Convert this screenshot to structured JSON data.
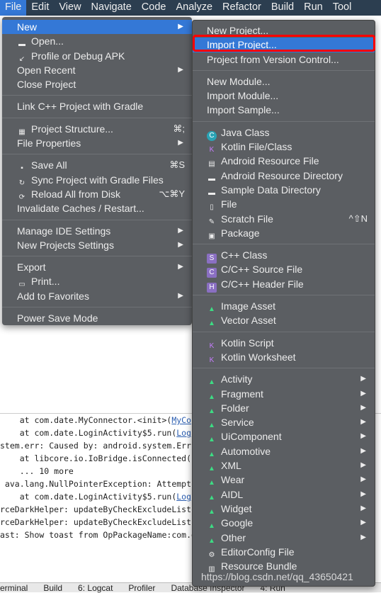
{
  "menubar": [
    "File",
    "Edit",
    "View",
    "Navigate",
    "Code",
    "Analyze",
    "Refactor",
    "Build",
    "Run",
    "Tool"
  ],
  "file_menu": [
    {
      "label": "New",
      "arrow": true,
      "selected": true
    },
    {
      "label": "Open...",
      "icon": "folder-icon"
    },
    {
      "label": "Profile or Debug APK",
      "icon": "profile-apk-icon"
    },
    {
      "label": "Open Recent",
      "arrow": true
    },
    {
      "label": "Close Project"
    },
    {
      "sep": true
    },
    {
      "label": "Link C++ Project with Gradle"
    },
    {
      "sep": true
    },
    {
      "label": "Project Structure...",
      "icon": "project-structure-icon",
      "shortcut": "⌘;"
    },
    {
      "label": "File Properties",
      "arrow": true
    },
    {
      "sep": true
    },
    {
      "label": "Save All",
      "icon": "save-icon",
      "shortcut": "⌘S"
    },
    {
      "label": "Sync Project with Gradle Files",
      "icon": "gradle-sync-icon"
    },
    {
      "label": "Reload All from Disk",
      "icon": "reload-icon",
      "shortcut": "⌥⌘Y"
    },
    {
      "label": "Invalidate Caches / Restart..."
    },
    {
      "sep": true
    },
    {
      "label": "Manage IDE Settings",
      "arrow": true
    },
    {
      "label": "New Projects Settings",
      "arrow": true
    },
    {
      "sep": true
    },
    {
      "label": "Export",
      "arrow": true
    },
    {
      "label": "Print...",
      "icon": "print-icon"
    },
    {
      "label": "Add to Favorites",
      "arrow": true
    },
    {
      "sep": true
    },
    {
      "label": "Power Save Mode"
    }
  ],
  "new_submenu": [
    {
      "label": "New Project..."
    },
    {
      "label": "Import Project...",
      "selected": true
    },
    {
      "label": "Project from Version Control..."
    },
    {
      "sep": true
    },
    {
      "label": "New Module..."
    },
    {
      "label": "Import Module..."
    },
    {
      "label": "Import Sample..."
    },
    {
      "sep": true
    },
    {
      "label": "Java Class",
      "icon": "java-class-icon"
    },
    {
      "label": "Kotlin File/Class",
      "icon": "kotlin-icon"
    },
    {
      "label": "Android Resource File",
      "icon": "android-resource-file-icon"
    },
    {
      "label": "Android Resource Directory",
      "icon": "folder-icon"
    },
    {
      "label": "Sample Data Directory",
      "icon": "folder-icon"
    },
    {
      "label": "File",
      "icon": "file-icon"
    },
    {
      "label": "Scratch File",
      "icon": "scratch-file-icon",
      "shortcut": "^⇧N"
    },
    {
      "label": "Package",
      "icon": "package-icon"
    },
    {
      "sep": true
    },
    {
      "label": "C++ Class",
      "icon": "cpp-class-icon"
    },
    {
      "label": "C/C++ Source File",
      "icon": "cpp-source-icon"
    },
    {
      "label": "C/C++ Header File",
      "icon": "cpp-header-icon"
    },
    {
      "sep": true
    },
    {
      "label": "Image Asset",
      "icon": "android-icon"
    },
    {
      "label": "Vector Asset",
      "icon": "android-icon"
    },
    {
      "sep": true
    },
    {
      "label": "Kotlin Script",
      "icon": "kotlin-icon"
    },
    {
      "label": "Kotlin Worksheet",
      "icon": "kotlin-icon"
    },
    {
      "sep": true
    },
    {
      "label": "Activity",
      "icon": "android-icon",
      "arrow": true
    },
    {
      "label": "Fragment",
      "icon": "android-icon",
      "arrow": true
    },
    {
      "label": "Folder",
      "icon": "android-icon",
      "arrow": true
    },
    {
      "label": "Service",
      "icon": "android-icon",
      "arrow": true
    },
    {
      "label": "UiComponent",
      "icon": "android-icon",
      "arrow": true
    },
    {
      "label": "Automotive",
      "icon": "android-icon",
      "arrow": true
    },
    {
      "label": "XML",
      "icon": "android-icon",
      "arrow": true
    },
    {
      "label": "Wear",
      "icon": "android-icon",
      "arrow": true
    },
    {
      "label": "AIDL",
      "icon": "android-icon",
      "arrow": true
    },
    {
      "label": "Widget",
      "icon": "android-icon",
      "arrow": true
    },
    {
      "label": "Google",
      "icon": "android-icon",
      "arrow": true
    },
    {
      "label": "Other",
      "icon": "android-icon",
      "arrow": true
    },
    {
      "label": "EditorConfig File",
      "icon": "gear-icon"
    },
    {
      "label": "Resource Bundle",
      "icon": "resource-bundle-icon"
    }
  ],
  "console_lines": [
    {
      "text": "    at com.date.MyConnector.<init>(",
      "link": "MyCo"
    },
    {
      "text": "    at com.date.LoginActivity$5.run(",
      "link": "Log"
    },
    {
      "text": "stem.err: Caused by: android.system.Errn"
    },
    {
      "text": "    at libcore.io.IoBridge.isConnected(I"
    },
    {
      "text": "    ... 10 more"
    },
    {
      "text": " ava.lang.NullPointerException: Attempt"
    },
    {
      "text": "    at com.date.LoginActivity$5.run(",
      "link": "Log"
    },
    {
      "text": "rceDarkHelper: updateByCheckExcludeList"
    },
    {
      "text": "rceDarkHelper: updateByCheckExcludeList"
    },
    {
      "text": "ast: Show toast from OpPackageName:com.d"
    }
  ],
  "bottom_tabs": [
    "erminal",
    "Build",
    "6: Logcat",
    "Profiler",
    "Database Inspector",
    "4: Run"
  ],
  "watermark": "https://blog.csdn.net/qq_43650421",
  "colors": {
    "menubar": "#2c3e50",
    "menu_bg": "#5b5e62",
    "selection": "#3478d6",
    "highlight_box": "#ff0000",
    "android_green": "#3ddc84"
  }
}
